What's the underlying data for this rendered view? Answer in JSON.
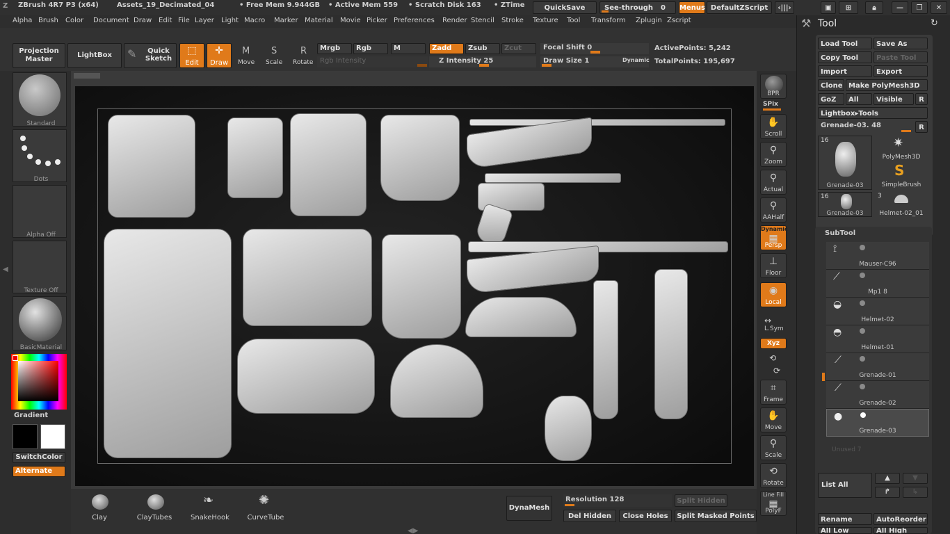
{
  "titlebar": {
    "app": "ZBrush 4R7 P3 (x64)",
    "document": "Assets_19_Decimated_04",
    "free_mem": "• Free Mem 9.944GB",
    "active_mem": "• Active Mem 559",
    "scratch": "• Scratch Disk 163",
    "ztime": "• ZTime",
    "quicksave": "QuickSave",
    "see_through": "See-through",
    "see_through_value": "0",
    "menus": "Menus",
    "default_script": "DefaultZScript"
  },
  "menus": [
    "Alpha",
    "Brush",
    "Color",
    "Document",
    "Draw",
    "Edit",
    "File",
    "Layer",
    "Light",
    "Macro",
    "Marker",
    "Material",
    "Movie",
    "Picker",
    "Preferences",
    "Render",
    "Stencil",
    "Stroke",
    "Texture",
    "Tool",
    "Transform",
    "Zplugin",
    "Zscript"
  ],
  "topshelf": {
    "projection_master": "Projection Master",
    "lightbox": "LightBox",
    "quick_sketch": "Quick Sketch",
    "edit": "Edit",
    "draw": "Draw",
    "move": "Move",
    "scale": "Scale",
    "rotate": "Rotate",
    "mrgb": "Mrgb",
    "rgb": "Rgb",
    "m": "M",
    "zadd": "Zadd",
    "zsub": "Zsub",
    "zcut": "Zcut",
    "rgb_intensity": "Rgb Intensity",
    "z_intensity": "Z Intensity 25",
    "focal_shift": "Focal Shift 0",
    "draw_size": "Draw Size 1",
    "dynamic": "Dynamic",
    "active_points": "ActivePoints: 5,242",
    "total_points": "TotalPoints: 195,697"
  },
  "leftshelf": {
    "brush": "Standard",
    "stroke": "Dots",
    "alpha": "Alpha  Off",
    "texture": "Texture  Off",
    "material": "BasicMaterial",
    "gradient": "Gradient",
    "switch_color": "SwitchColor",
    "alternate": "Alternate"
  },
  "rightshelf": [
    "BPR",
    "SPix",
    "Scroll",
    "Zoom",
    "Actual",
    "AAHalf",
    "Persp",
    "Floor",
    "Local",
    "L.Sym",
    "Xyz",
    "Frame",
    "Move",
    "Scale",
    "Rotate",
    "PolyF"
  ],
  "rightshelf_extra": {
    "dynamic": "Dynamic",
    "line_fill": "Line Fill"
  },
  "bottomshelf": {
    "brushes": [
      "Clay",
      "ClayTubes",
      "SnakeHook",
      "CurveTube"
    ],
    "dynamesh": "DynaMesh",
    "resolution": "Resolution 128",
    "split_hidden": "Split Hidden",
    "del_hidden": "Del Hidden",
    "close_holes": "Close Holes",
    "split_masked": "Split Masked Points"
  },
  "tool_panel": {
    "title": "Tool",
    "load_tool": "Load Tool",
    "save_as": "Save As",
    "copy_tool": "Copy Tool",
    "paste_tool": "Paste Tool",
    "import": "Import",
    "export": "Export",
    "clone": "Clone",
    "make_polymesh": "Make PolyMesh3D",
    "goz": "GoZ",
    "all": "All",
    "visible": "Visible",
    "r": "R",
    "lightbox_tools": "Lightbox▸Tools",
    "current_tool": "Grenade-03. 48",
    "thumbs": [
      {
        "name": "Grenade-03",
        "count": "16"
      },
      {
        "name": "PolyMesh3D",
        "count": ""
      },
      {
        "name": "SimpleBrush",
        "count": ""
      },
      {
        "name": "Grenade-03",
        "count": "16"
      },
      {
        "name": "Helmet-02_01",
        "count": "3"
      }
    ]
  },
  "subtool": {
    "title": "SubTool",
    "items": [
      "Mauser-C96",
      "Mp1 8",
      "Helmet-02",
      "Helmet-01",
      "Grenade-01",
      "Grenade-02",
      "Grenade-03"
    ],
    "unused": "Unused 7",
    "list_all": "List  All",
    "rename": "Rename",
    "auto_reorder": "AutoReorder",
    "all_low": "All Low",
    "all_high": "All High"
  },
  "colors": {
    "accent": "#e07a1a"
  }
}
